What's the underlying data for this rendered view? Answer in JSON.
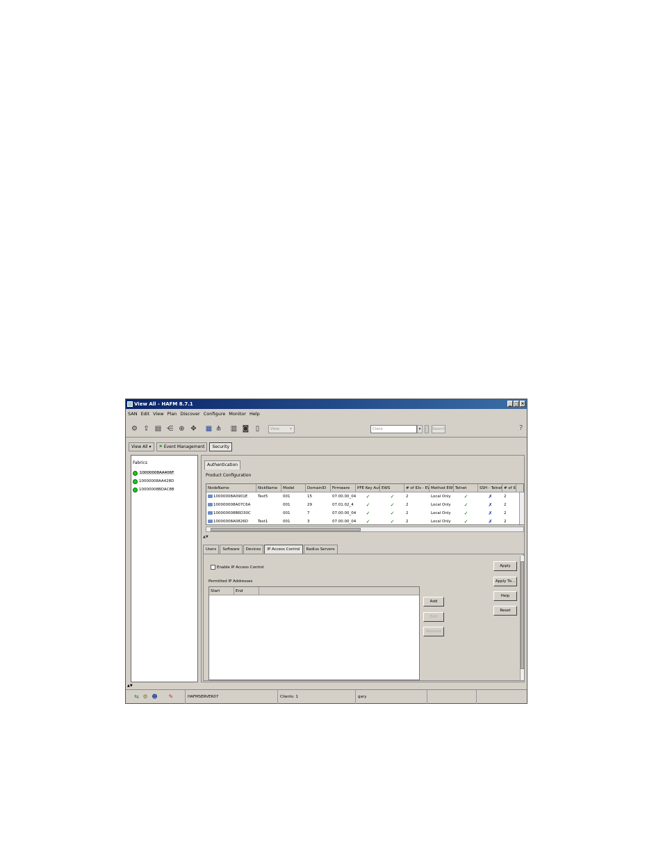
{
  "window": {
    "title": "View All - HAFM 8.7.1",
    "controls": [
      "_",
      "□",
      "×"
    ]
  },
  "menu": [
    "SAN",
    "Edit",
    "View",
    "Plan",
    "Discover",
    "Configure",
    "Monitor",
    "Help"
  ],
  "toolbar": {
    "view_select": "View",
    "search_value": "Cisco",
    "search_button": "Search",
    "help_icon": "?",
    "icons": [
      "hafm-icon",
      "export-icon",
      "document-icon",
      "topology-icon",
      "zoom-icon",
      "move-icon",
      "table-icon",
      "diagram-icon",
      "library-icon",
      "camera-icon",
      "report-icon"
    ]
  },
  "view_tabs": [
    "View All ▾",
    "Event Management",
    "Security"
  ],
  "left_pane": {
    "header": "Fabrics",
    "fabrics": [
      "10000008AA406F",
      "10000008AA428D",
      "10000008BDAC8B"
    ]
  },
  "right_pane": {
    "auth_tab": "Authentication",
    "product_config_label": "Product Configuration",
    "columns": [
      "NodeName",
      "NickName",
      "Model",
      "DomainID",
      "Firmware",
      "PFE Key Aut...",
      "EWS",
      "# of IDs - EWS",
      "Method EWS",
      "Telnet",
      "SSH - Telnet",
      "# of IDs..."
    ],
    "rows": [
      {
        "node": "10000008A0901E",
        "nick": "Test5",
        "model": "001",
        "domain": "15",
        "firmware": "07.00.00_04",
        "pfe": "✓",
        "ews": "✓",
        "ids_ews": "2",
        "method": "Local Only",
        "telnet": "✓",
        "ssh": "✗",
        "ids": "2"
      },
      {
        "node": "100000008A07C6A",
        "nick": "",
        "model": "001",
        "domain": "29",
        "firmware": "07.01.02_4",
        "pfe": "✓",
        "ews": "✓",
        "ids_ews": "2",
        "method": "Local Only",
        "telnet": "✓",
        "ssh": "✗",
        "ids": "2"
      },
      {
        "node": "100000008B6D30C",
        "nick": "",
        "model": "001",
        "domain": "7",
        "firmware": "07.00.00_04",
        "pfe": "✓",
        "ews": "✓",
        "ids_ews": "2",
        "method": "Local Only",
        "telnet": "✓",
        "ssh": "✗",
        "ids": "2"
      },
      {
        "node": "10000008A0826D",
        "nick": "Test1",
        "model": "001",
        "domain": "3",
        "firmware": "07.00.00_04",
        "pfe": "✓",
        "ews": "✓",
        "ids_ews": "2",
        "method": "Local Only",
        "telnet": "✓",
        "ssh": "✗",
        "ids": "2"
      }
    ],
    "splitter": "▲▼",
    "bottom_tabs": [
      "Users",
      "Software",
      "Devices",
      "IP Access Control",
      "Radius Servers"
    ],
    "active_bottom_tab": "IP Access Control",
    "enable_ip_label": "Enable IP Access Control",
    "permitted_label": "Permitted IP Addresses",
    "ip_columns": [
      "Start",
      "End"
    ],
    "buttons": {
      "add": "Add",
      "edit": "Edit",
      "remove": "Remove",
      "apply": "Apply",
      "apply_to": "Apply To...",
      "help": "Help",
      "reset": "Reset"
    }
  },
  "status_bar": {
    "splitter": "▲▼",
    "server": "HAFMSERVER07",
    "clients": "Clients: 1",
    "user": "gary"
  },
  "colors": {
    "title_start": "#0a246a",
    "title_end": "#3a6ea5",
    "chrome": "#d4d0c8",
    "fabric_ok": "#22c422",
    "check": "#006000",
    "cross": "#1a2a9a"
  }
}
